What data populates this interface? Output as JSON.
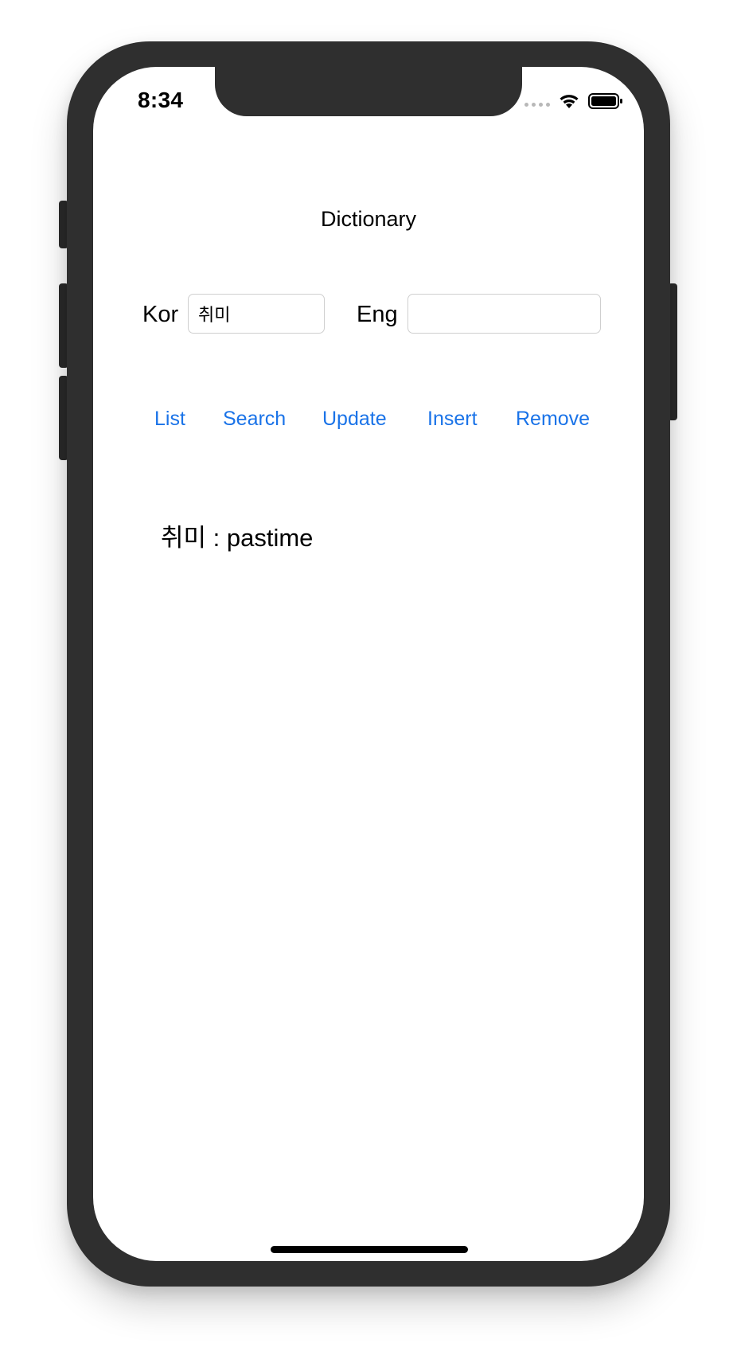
{
  "status_bar": {
    "time": "8:34",
    "icons": [
      "signal-icon",
      "wifi-icon",
      "battery-icon"
    ]
  },
  "screen": {
    "title": "Dictionary"
  },
  "form": {
    "kor_label": "Kor",
    "kor_value": "취미",
    "eng_label": "Eng",
    "eng_value": ""
  },
  "actions": {
    "list": "List",
    "search": "Search",
    "update": "Update",
    "insert": "Insert",
    "remove": "Remove"
  },
  "result": {
    "text": "취미 : pastime"
  },
  "colors": {
    "accent": "#1a73e8",
    "frame": "#2f2f2f"
  }
}
